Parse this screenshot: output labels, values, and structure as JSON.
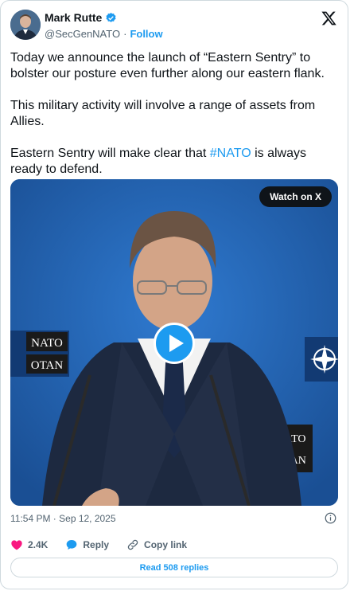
{
  "author": {
    "name": "Mark Rutte",
    "handle": "@SecGenNATO",
    "separator": "·",
    "follow_label": "Follow"
  },
  "tweet": {
    "paragraph_1": "Today we announce the launch of “Eastern Sentry” to bolster our posture even further along our eastern flank.",
    "paragraph_2": "This military activity will involve a range of assets from Allies.",
    "paragraph_3_before": "Eastern Sentry will make clear that ",
    "hashtag": "#NATO",
    "paragraph_3_after": " is always ready to defend."
  },
  "media": {
    "watch_label": "Watch on X",
    "backdrop_left_top": "NATO",
    "backdrop_left_bottom": "OTAN",
    "backdrop_right_top": "ATO",
    "backdrop_right_bottom": "TAN"
  },
  "timestamp": "11:54 PM · Sep 12, 2025",
  "actions": {
    "likes": "2.4K",
    "reply_label": "Reply",
    "copy_link_label": "Copy link"
  },
  "read_replies_label": "Read 508 replies",
  "colors": {
    "accent": "#1d9bf0",
    "like": "#f91880",
    "text": "#0f1419",
    "muted": "#536471",
    "border": "#cfd9de",
    "video_background": "#1f5fa8"
  }
}
